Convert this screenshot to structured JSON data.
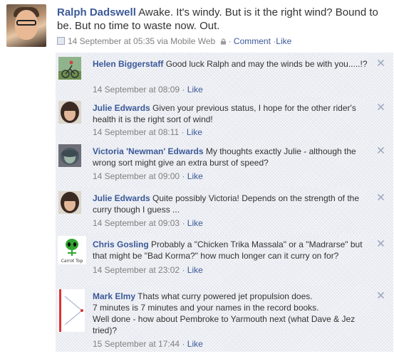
{
  "post": {
    "author": "Ralph Dadswell",
    "text": "Awake. It's windy. But is it the right wind? Bound to be. But no time to waste now. Out.",
    "timestamp": "14 September at 05:35 via Mobile Web",
    "sep": "·",
    "comment_link": "Comment",
    "like_link": "Like"
  },
  "comments": [
    {
      "author": "Helen Biggerstaff",
      "text": "Good luck Ralph and may the winds be with you.....!?",
      "timestamp": "14 September at 08:09",
      "like": "Like"
    },
    {
      "author": "Julie Edwards",
      "text": "Given your previous status, I hope for the other rider's health it is the right sort of wind!",
      "timestamp": "14 September at 08:11",
      "like": "Like"
    },
    {
      "author": "Victoria 'Newman' Edwards",
      "text": "My thoughts exactly Julie - although the wrong sort might give an extra burst of speed?",
      "timestamp": "14 September at 09:00",
      "like": "Like"
    },
    {
      "author": "Julie Edwards",
      "text": "Quite possibly Victoria! Depends on the strength of the curry though I guess ...",
      "timestamp": "14 September at 09:03",
      "like": "Like"
    },
    {
      "author": "Chris Gosling",
      "text": "Probably a \"Chicken Trika Massala\" or a \"Madrarse\" but that might be \"Bad Korma?\" how much longer can it curry on for?",
      "timestamp": "14 September at 23:02",
      "like": "Like"
    },
    {
      "author": "Mark Elmy",
      "text": "Thats what curry powered jet propulsion does.\n7 minutes is 7 minutes and your names in the record books.\nWell done - how about Pembroke to Yarmouth next (what Dave & Jez tried)?",
      "timestamp": "15 September at 17:44",
      "like": "Like"
    }
  ],
  "avatar_caption": "Carrot Top",
  "colors": {
    "link": "#3b5998",
    "meta": "#808080",
    "comment_bg": "#edeff4"
  },
  "icons": [
    "mobile-icon",
    "lock-icon",
    "close-icon"
  ]
}
